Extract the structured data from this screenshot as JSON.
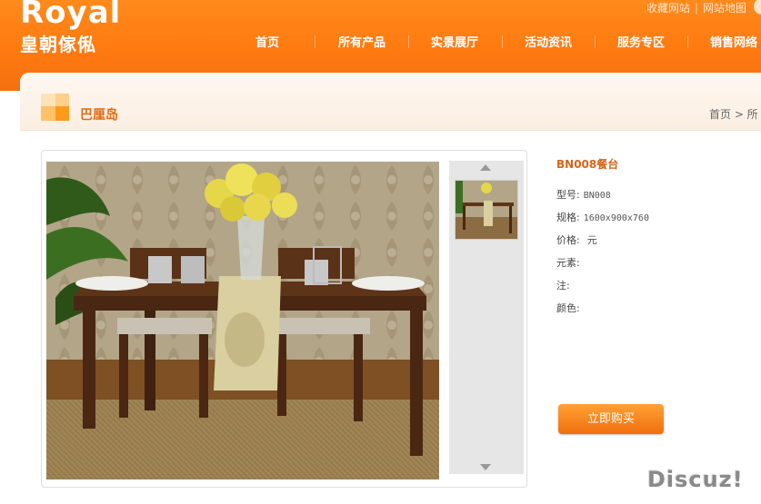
{
  "brand": {
    "name_en": "Royal",
    "name_cn": "皇朝傢俬"
  },
  "top_links": [
    "收藏网站",
    "网站地图"
  ],
  "nav": [
    "首页",
    "所有产品",
    "实景展厅",
    "活动资讯",
    "服务专区",
    "销售网络"
  ],
  "page": {
    "title": "巴厘岛",
    "breadcrumb": "首页 > 所"
  },
  "product": {
    "name": "BN008餐台",
    "specs": [
      {
        "label": "型号:",
        "value": "BN008"
      },
      {
        "label": "规格:",
        "value": "1600x900x760"
      },
      {
        "label": "价格:",
        "value": "元"
      },
      {
        "label": "元素:",
        "value": ""
      },
      {
        "label": "注:",
        "value": ""
      },
      {
        "label": "颜色:",
        "value": ""
      }
    ],
    "buy_label": "立即购买"
  },
  "watermark": "Discuz!",
  "colors": {
    "header_orange": "#ff7f14",
    "title_orange": "#e06a10",
    "button_orange": "#f47a18"
  }
}
